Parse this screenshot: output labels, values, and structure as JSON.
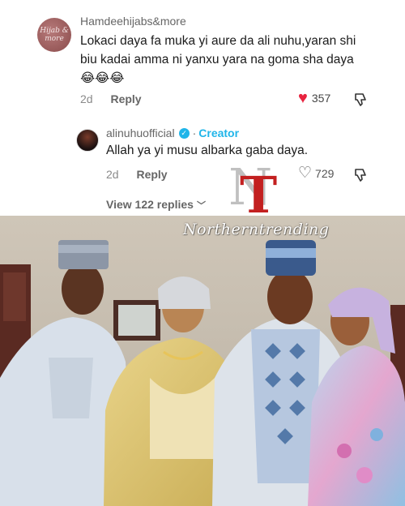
{
  "comment1": {
    "username": "Hamdeehijabs&more",
    "text": "Lokaci daya fa muka yi aure da ali nuhu,yaran shi biu kadai amma ni yanxu yara na goma sha daya😂😂😂",
    "time": "2d",
    "reply_label": "Reply",
    "likes": "357",
    "liked": true,
    "avatar_text": "Hijab & more"
  },
  "comment2": {
    "username": "alinuhuofficial",
    "separator": "·",
    "badge": "Creator",
    "text": "Allah ya yi musu albarka gaba daya.",
    "time": "2d",
    "reply_label": "Reply",
    "likes": "729",
    "liked": false
  },
  "view_replies": {
    "label": "View 122 replies"
  },
  "watermark": {
    "letters": [
      "N",
      "T"
    ],
    "text": "Northerntrending"
  },
  "colors": {
    "heart": "#e8233f",
    "creator_blue": "#20b5e9",
    "watermark_red": "#c32020"
  },
  "icons": [
    "heart-icon",
    "heart-outline-icon",
    "dislike-icon",
    "verified-badge-icon",
    "chevron-down-icon"
  ]
}
